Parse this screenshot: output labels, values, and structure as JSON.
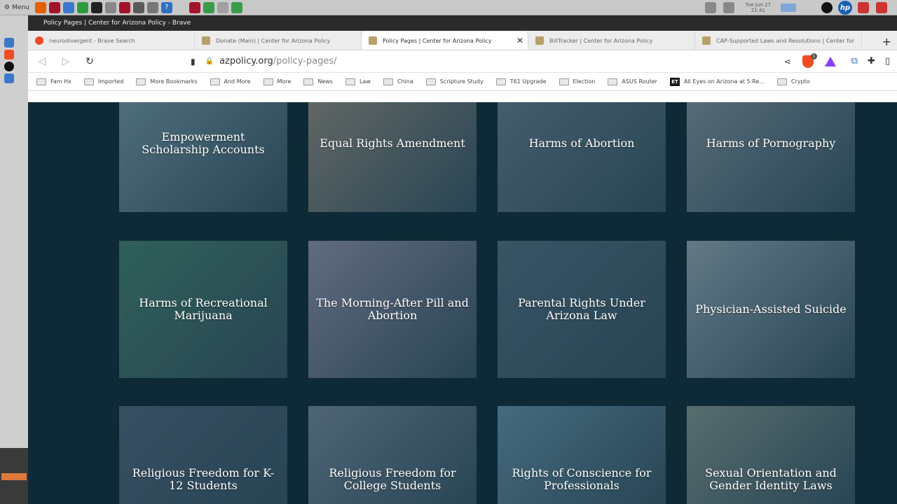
{
  "taskbar": {
    "menu_label": "Menu",
    "clock_line1": "Tue Jun 27",
    "clock_line2": "21:41"
  },
  "browser": {
    "window_title": "Policy Pages | Center for Arizona Policy - Brave",
    "tabs": [
      {
        "label": "neurodivergent - Brave Search",
        "active": false
      },
      {
        "label": "Donate (Main) | Center for Arizona Policy",
        "active": false
      },
      {
        "label": "Policy Pages | Center for Arizona Policy",
        "active": true
      },
      {
        "label": "BillTracker | Center for Arizona Policy",
        "active": false
      },
      {
        "label": "CAP-Supported Laws and Resolutions | Center for",
        "active": false
      }
    ],
    "url_domain": "azpolicy.org",
    "url_path": "/policy-pages/",
    "shield_badge": "1",
    "bookmarks": [
      {
        "label": "Fam Hx",
        "icon": "folder-icon"
      },
      {
        "label": "Imported",
        "icon": "folder-icon"
      },
      {
        "label": "More Bookmarks",
        "icon": "folder-icon"
      },
      {
        "label": "And More",
        "icon": "folder-icon"
      },
      {
        "label": "More",
        "icon": "folder-icon"
      },
      {
        "label": "News",
        "icon": "folder-icon"
      },
      {
        "label": "Law",
        "icon": "folder-icon"
      },
      {
        "label": "China",
        "icon": "folder-icon"
      },
      {
        "label": "Scripture Study",
        "icon": "folder-icon"
      },
      {
        "label": "T61 Upgrade",
        "icon": "folder-icon"
      },
      {
        "label": "Election",
        "icon": "folder-icon"
      },
      {
        "label": "ASUS Router",
        "icon": "folder-icon"
      },
      {
        "label": "All Eyes on Arizona at 5 Re...",
        "icon": "et-icon"
      },
      {
        "label": "Crypto",
        "icon": "folder-icon"
      }
    ]
  },
  "policy_cards": [
    {
      "title": "Empowerment Scholarship Accounts",
      "color": "#6e8f9a"
    },
    {
      "title": "Equal Rights Amendment",
      "color": "#8a8478"
    },
    {
      "title": "Harms of Abortion",
      "color": "#5f7582"
    },
    {
      "title": "Harms of Pornography",
      "color": "#7a8a94"
    },
    {
      "title": "Harms of Recreational Marijuana",
      "color": "#3f7a66"
    },
    {
      "title": "The Morning-After Pill and Abortion",
      "color": "#8c8aa0"
    },
    {
      "title": "Parental Rights Under Arizona Law",
      "color": "#4c6778"
    },
    {
      "title": "Physician-Assisted Suicide",
      "color": "#8da0ab"
    },
    {
      "title": "Religious Freedom for K-12 Students",
      "color": "#4a5f72"
    },
    {
      "title": "Religious Freedom for College Students",
      "color": "#6f8293"
    },
    {
      "title": "Rights of Conscience for Professionals",
      "color": "#5f8aa0"
    },
    {
      "title": "Sexual Orientation and Gender Identity Laws",
      "color": "#7c8d86"
    }
  ]
}
